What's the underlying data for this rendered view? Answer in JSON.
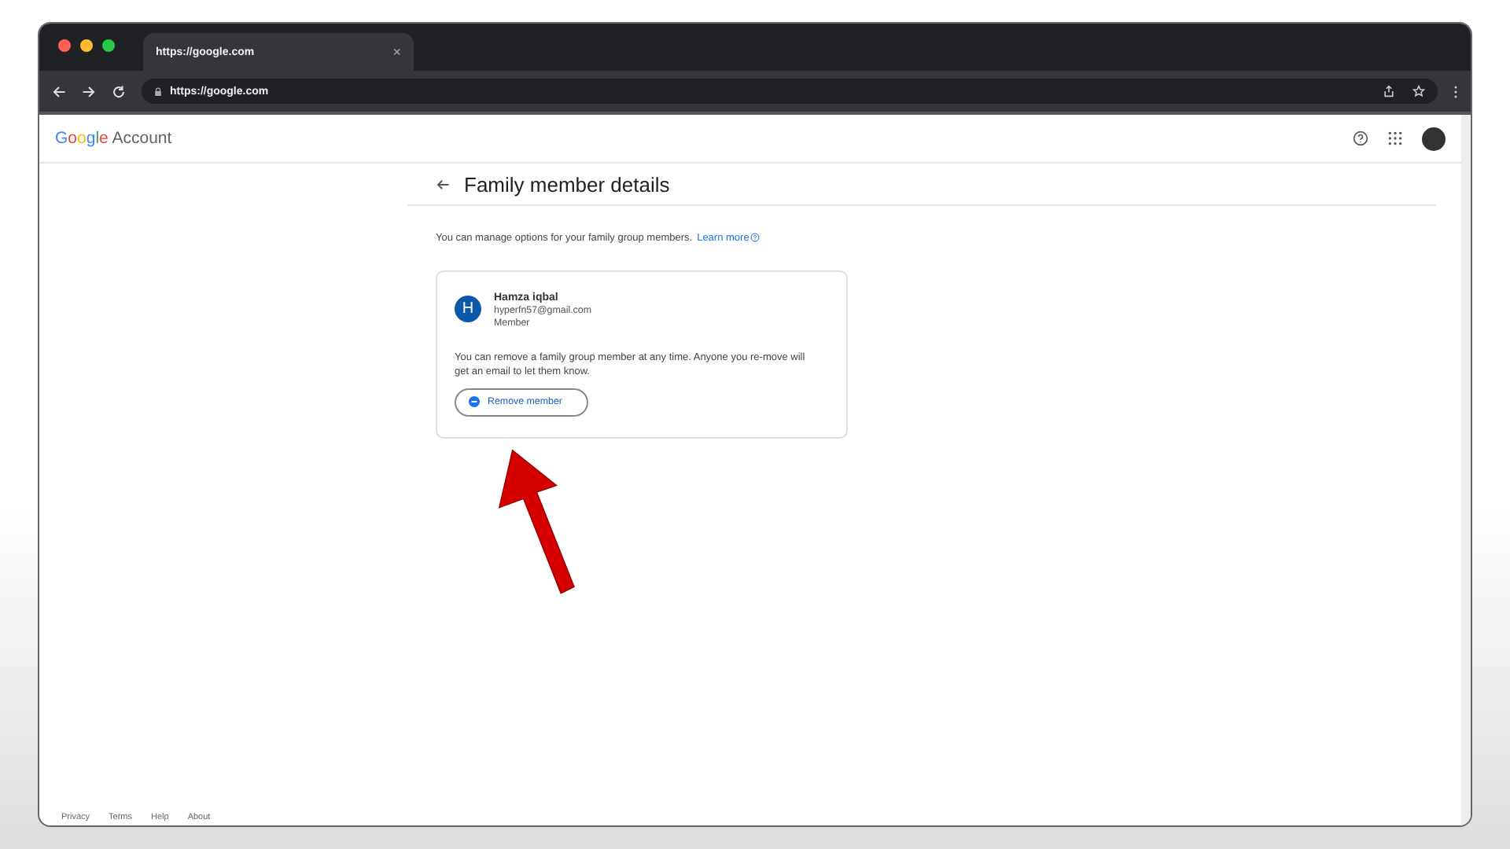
{
  "browser": {
    "tab_title": "https://google.com",
    "tab_close": "×",
    "address": "https://google.com"
  },
  "header": {
    "logo": "Google",
    "product": "Account"
  },
  "page": {
    "title": "Family member details",
    "intro": "You can manage options for your family group members.",
    "learn_more": "Learn more"
  },
  "member": {
    "initial": "H",
    "name": "Hamza iqbal",
    "email": "hyperfn57@gmail.com",
    "role": "Member",
    "note": "You can remove a family group member at any time. Anyone you re-move will get an email to let them know.",
    "button": "Remove member"
  },
  "footer": [
    "Privacy",
    "Terms",
    "Help",
    "About"
  ]
}
